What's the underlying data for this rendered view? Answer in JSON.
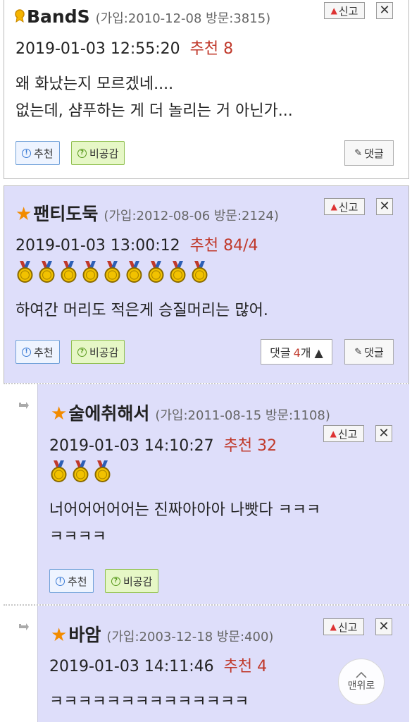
{
  "common": {
    "report_label": "신고",
    "close_glyph": "✕",
    "upvote_label": "추천",
    "downvote_label": "비공감",
    "reply_label": "댓글",
    "scroll_top_label": "맨위로",
    "star_glyph": "★",
    "replies_label": "댓글",
    "replies_unit": "개 ▲"
  },
  "comments": [
    {
      "nickname": "BandS",
      "meta": "(가입:2010-12-08 방문:3815)",
      "date": "2019-01-03 12:55:20",
      "recommend": "추천 8",
      "lines": [
        "왜 화났는지 모르겠네....",
        "없는데, 샴푸하는 게 더 놀리는 거 아닌가..."
      ]
    },
    {
      "nickname": "팬티도둑",
      "meta": "(가입:2012-08-06 방문:2124)",
      "date": "2019-01-03 13:00:12",
      "recommend": "추천 84/4",
      "medal_count": 9,
      "lines": [
        "하여간 머리도 적은게 승질머리는 많어."
      ],
      "reply_count": "4"
    },
    {
      "nickname": "술에취해서",
      "meta": "(가입:2011-08-15 방문:1108)",
      "date": "2019-01-03 14:10:27",
      "recommend": "추천 32",
      "medal_count": 3,
      "lines": [
        "너어어어어어는 진짜아아아 나빳다 ㅋㅋㅋ",
        "ㅋㅋㅋㅋ"
      ]
    },
    {
      "nickname": "바암",
      "meta": "(가입:2003-12-18 방문:400)",
      "date": "2019-01-03 14:11:46",
      "recommend": "추천 4",
      "lines": [
        "ㅋㅋㅋㅋㅋㅋㅋㅋㅋㅋㅋㅋㅋㅋ"
      ]
    }
  ],
  "colors": {
    "card_blue": "#dedefa",
    "recommend_red": "#c0392b",
    "star_orange": "#f28b00",
    "upvote_border": "#6fa0d8",
    "downvote_bg": "#e6f7c6"
  }
}
